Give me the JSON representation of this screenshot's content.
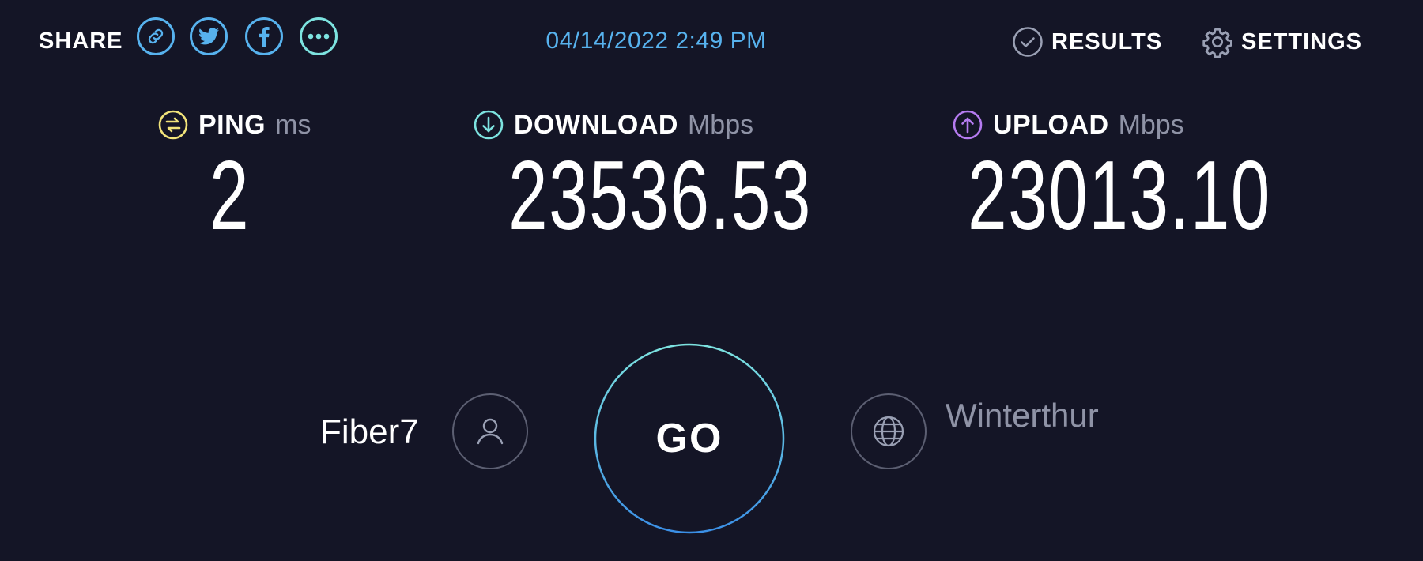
{
  "share": {
    "label": "SHARE",
    "buttons": [
      {
        "icon": "link-icon"
      },
      {
        "icon": "twitter-icon"
      },
      {
        "icon": "facebook-icon"
      },
      {
        "icon": "more-icon"
      }
    ]
  },
  "timestamp": "04/14/2022 2:49 PM",
  "nav": {
    "results_label": "RESULTS",
    "settings_label": "SETTINGS"
  },
  "metrics": {
    "ping": {
      "label": "PING",
      "unit": "ms",
      "value": "2"
    },
    "download": {
      "label": "DOWNLOAD",
      "unit": "Mbps",
      "value": "23536.53"
    },
    "upload": {
      "label": "UPLOAD",
      "unit": "Mbps",
      "value": "23013.10"
    }
  },
  "provider": {
    "name": "Fiber7",
    "icon": "user-icon"
  },
  "server": {
    "name": "Winterthur",
    "icon": "globe-icon"
  },
  "go_button": {
    "label": "GO"
  },
  "colors": {
    "background": "#141526",
    "accent_blue": "#57b2ee",
    "accent_teal": "#7de3e0",
    "ping_yellow": "#f2e47a",
    "upload_purple": "#b57bf0",
    "muted_text": "#8f93a6"
  }
}
